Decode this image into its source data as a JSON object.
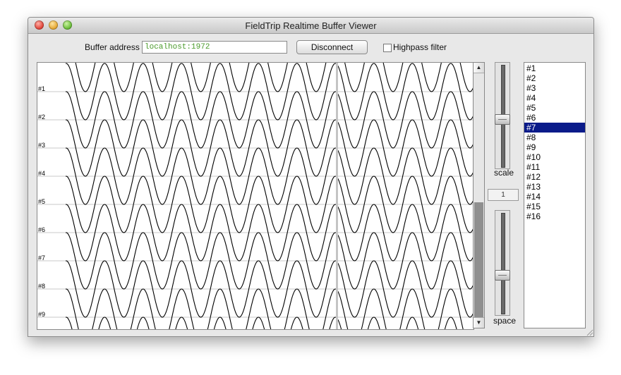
{
  "window": {
    "title": "FieldTrip Realtime Buffer Viewer"
  },
  "toolbar": {
    "address_label": "Buffer address",
    "address_value": "localhost:1972",
    "disconnect_label": "Disconnect",
    "highpass_label": "Highpass filter",
    "highpass_checked": false
  },
  "plot": {
    "channel_labels": [
      "#1",
      "#2",
      "#3",
      "#4",
      "#5",
      "#6",
      "#7",
      "#8",
      "#9"
    ]
  },
  "controls": {
    "scale_label": "scale",
    "scale_value": "1",
    "space_label": "space",
    "scale_slider_level": 0.45,
    "space_slider_level": 0.36
  },
  "channels": {
    "items": [
      "#1",
      "#2",
      "#3",
      "#4",
      "#5",
      "#6",
      "#7",
      "#8",
      "#9",
      "#10",
      "#11",
      "#12",
      "#13",
      "#14",
      "#15",
      "#16"
    ],
    "selected_index": 6
  },
  "colors": {
    "selection": "#0a1b8a",
    "address_text": "#4a9a2a",
    "trace": "#000000"
  }
}
